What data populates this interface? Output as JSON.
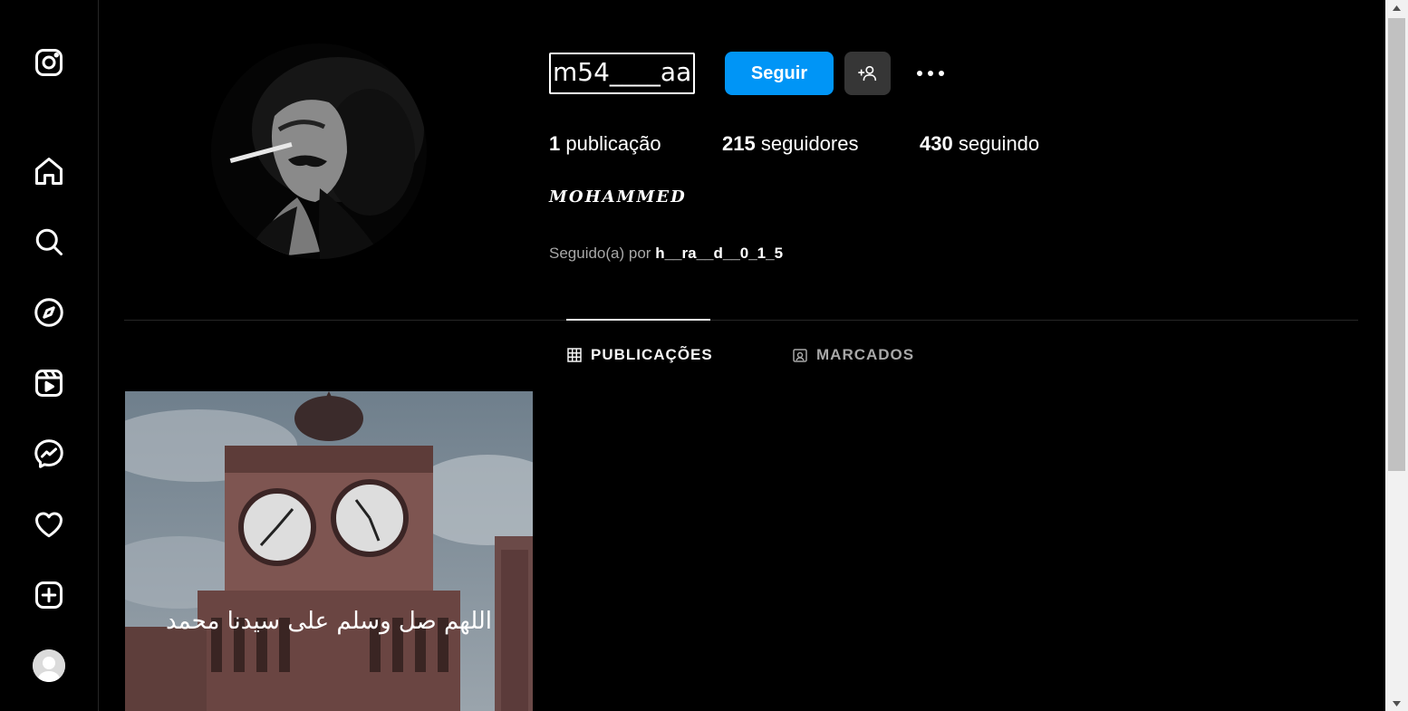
{
  "sidebar": {
    "items": [
      {
        "name": "instagram-logo-icon"
      },
      {
        "name": "home-icon"
      },
      {
        "name": "search-icon"
      },
      {
        "name": "explore-icon"
      },
      {
        "name": "reels-icon"
      },
      {
        "name": "messenger-icon"
      },
      {
        "name": "heart-icon"
      },
      {
        "name": "create-icon"
      }
    ]
  },
  "profile": {
    "username": "m54____aa",
    "follow_label": "Seguir",
    "posts_count": "1",
    "posts_label": "publicação",
    "followers_count": "215",
    "followers_label": "seguidores",
    "following_count": "430",
    "following_label": "seguindo",
    "full_name": "MOHAMMED",
    "followed_by_prefix": "Seguido(a) por",
    "followed_by_user": "h__ra__d__0_1_5"
  },
  "tabs": [
    {
      "label": "PUBLICAÇÕES",
      "active": true
    },
    {
      "label": "MARCADOS",
      "active": false
    }
  ],
  "post": {
    "caption_arabic": "اللهم صل وسلم على سيدنا محمد"
  },
  "colors": {
    "background": "#000000",
    "accent": "#0095f6",
    "secondary_button": "#363636",
    "muted_text": "#a8a8a8",
    "divider": "#262626"
  }
}
